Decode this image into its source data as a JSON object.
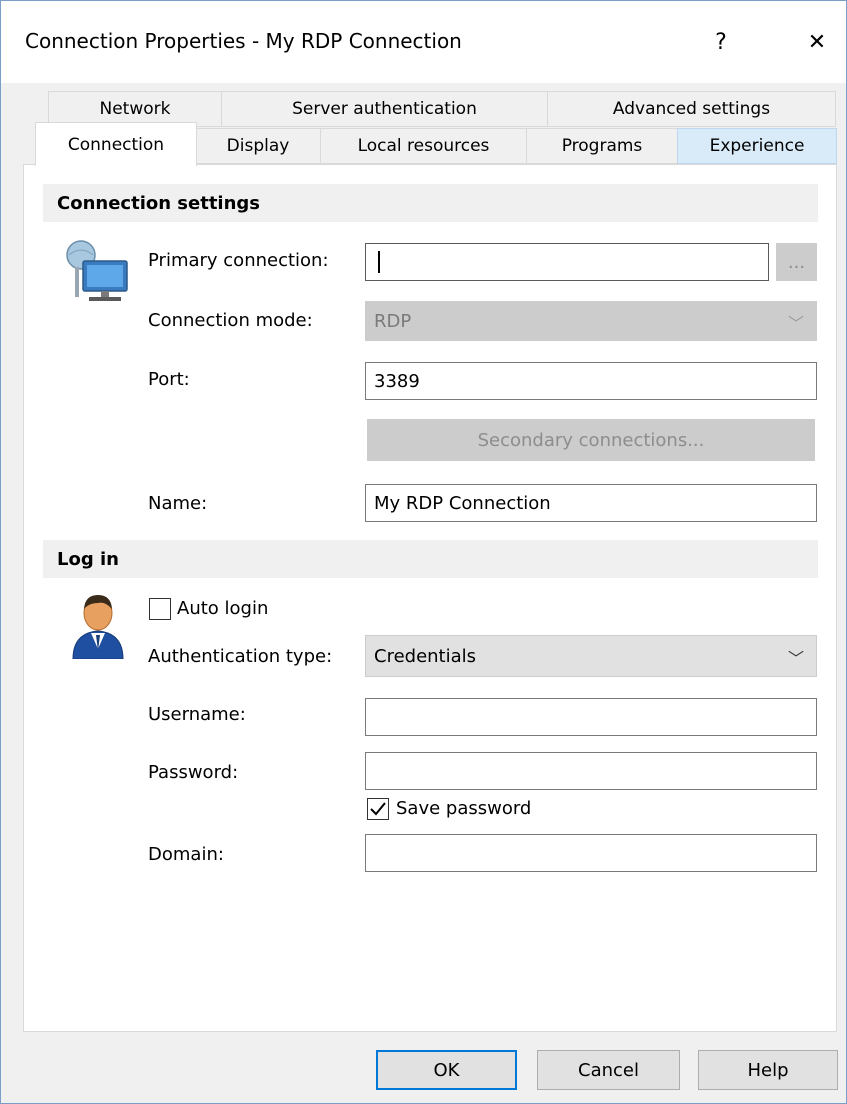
{
  "window": {
    "title": "Connection Properties - My RDP Connection",
    "help_glyph": "?",
    "close_glyph": "✕"
  },
  "tabs": {
    "row1": [
      {
        "label": "Network"
      },
      {
        "label": "Server authentication"
      },
      {
        "label": "Advanced settings"
      }
    ],
    "row2": [
      {
        "label": "Connection",
        "active": true
      },
      {
        "label": "Display"
      },
      {
        "label": "Local resources"
      },
      {
        "label": "Programs"
      },
      {
        "label": "Experience",
        "hover": true
      }
    ]
  },
  "connection_settings": {
    "header": "Connection settings",
    "primary_connection_label": "Primary connection:",
    "primary_connection_value": "",
    "browse_label": "...",
    "connection_mode_label": "Connection mode:",
    "connection_mode_value": "RDP",
    "port_label": "Port:",
    "port_value": "3389",
    "secondary_connections_label": "Secondary connections...",
    "name_label": "Name:",
    "name_value": "My RDP Connection"
  },
  "log_in": {
    "header": "Log in",
    "auto_login_label": "Auto login",
    "auto_login_checked": false,
    "auth_type_label": "Authentication type:",
    "auth_type_value": "Credentials",
    "username_label": "Username:",
    "username_value": "",
    "password_label": "Password:",
    "password_value": "",
    "save_password_label": "Save password",
    "save_password_checked": true,
    "domain_label": "Domain:",
    "domain_value": ""
  },
  "footer": {
    "ok_label": "OK",
    "cancel_label": "Cancel",
    "help_label": "Help"
  },
  "colors": {
    "accent": "#0078d7",
    "tab_hover": "#d9ebf9",
    "section_bg": "#f0f0f0"
  }
}
